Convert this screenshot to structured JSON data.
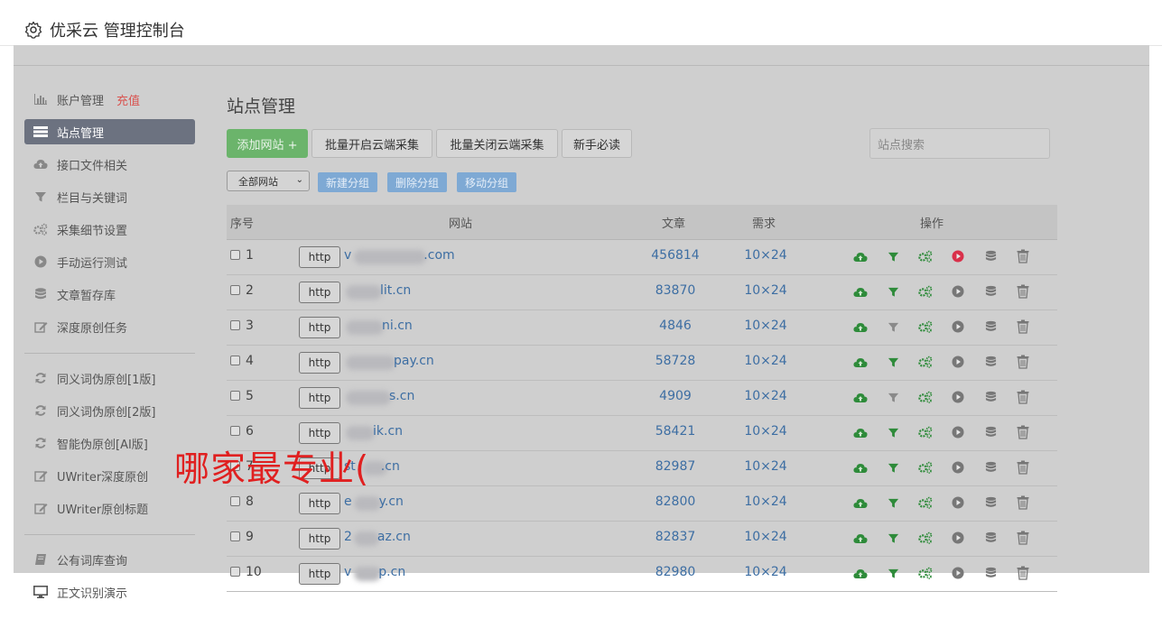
{
  "header": {
    "title": "优采云 管理控制台"
  },
  "sidebar": {
    "items": [
      {
        "label": "账户管理",
        "badge": "充值",
        "icon": "bar-chart-icon"
      },
      {
        "label": "站点管理",
        "icon": "list-icon",
        "active": true
      },
      {
        "label": "接口文件相关",
        "icon": "cloud-upload-icon"
      },
      {
        "label": "栏目与关键词",
        "icon": "filter-icon"
      },
      {
        "label": "采集细节设置",
        "icon": "gears-icon"
      },
      {
        "label": "手动运行测试",
        "icon": "play-icon"
      },
      {
        "label": "文章暂存库",
        "icon": "database-icon"
      },
      {
        "label": "深度原创任务",
        "icon": "edit-icon"
      },
      {
        "label": "同义词伪原创[1版]",
        "icon": "refresh-icon"
      },
      {
        "label": "同义词伪原创[2版]",
        "icon": "refresh-icon"
      },
      {
        "label": "智能伪原创[AI版]",
        "icon": "refresh-icon"
      },
      {
        "label": "UWriter深度原创",
        "icon": "edit-icon"
      },
      {
        "label": "UWriter原创标题",
        "icon": "edit-icon"
      },
      {
        "label": "公有词库查询",
        "icon": "book-icon"
      },
      {
        "label": "正文识别演示",
        "icon": "monitor-icon"
      }
    ]
  },
  "main": {
    "title": "站点管理",
    "toolbar": {
      "add_site": "添加网站 +",
      "batch_open": "批量开启云端采集",
      "batch_close": "批量关闭云端采集",
      "guide": "新手必读"
    },
    "search": {
      "placeholder": "站点搜索"
    },
    "group_select": "全部网站",
    "group_buttons": {
      "new": "新建分组",
      "delete": "删除分组",
      "move": "移动分组"
    },
    "table": {
      "headers": {
        "seq": "序号",
        "site": "网站",
        "articles": "文章",
        "demand": "需求",
        "ops": "操作"
      },
      "http_label": "http",
      "rows": [
        {
          "seq": "1",
          "site_left": "v",
          "site_right": ".com",
          "articles": "456814",
          "demand": "10×24",
          "running": true
        },
        {
          "seq": "2",
          "site_left": "",
          "site_right": "lit.cn",
          "articles": "83870",
          "demand": "10×24",
          "running": false
        },
        {
          "seq": "3",
          "site_left": "",
          "site_right": "ni.cn",
          "articles": "4846",
          "demand": "10×24",
          "running": false
        },
        {
          "seq": "4",
          "site_left": "",
          "site_right": "pay.cn",
          "articles": "58728",
          "demand": "10×24",
          "running": false
        },
        {
          "seq": "5",
          "site_left": "",
          "site_right": "s.cn",
          "articles": "4909",
          "demand": "10×24",
          "running": false
        },
        {
          "seq": "6",
          "site_left": "",
          "site_right": "ik.cn",
          "articles": "58421",
          "demand": "10×24",
          "running": false
        },
        {
          "seq": "7",
          "site_left": "st",
          "site_right": ".cn",
          "articles": "82987",
          "demand": "10×24",
          "running": false
        },
        {
          "seq": "8",
          "site_left": "e",
          "site_right": "y.cn",
          "articles": "82800",
          "demand": "10×24",
          "running": false
        },
        {
          "seq": "9",
          "site_left": "2",
          "site_right": "az.cn",
          "articles": "82837",
          "demand": "10×24",
          "running": false
        },
        {
          "seq": "10",
          "site_left": "v",
          "site_right": "p.cn",
          "articles": "82980",
          "demand": "10×24",
          "running": false
        }
      ]
    }
  },
  "watermark": "哪家最专业(",
  "colors": {
    "accent_green": "#4caf50",
    "link_blue": "#3d6ea3",
    "danger_red": "#d9534f",
    "overlay_gray": "#cfcfcf"
  }
}
